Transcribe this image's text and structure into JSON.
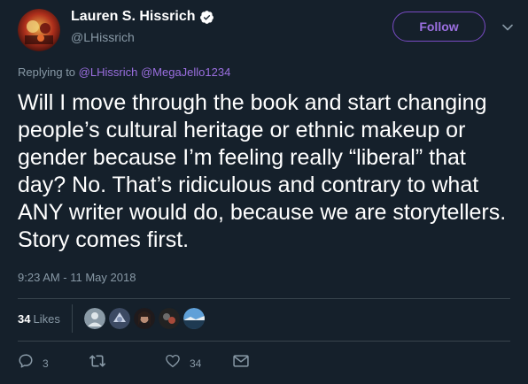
{
  "author": {
    "name": "Lauren S. Hissrich",
    "handle": "@LHissrich",
    "verified_icon": "verified-badge-icon",
    "follow_label": "Follow"
  },
  "reply": {
    "prefix": "Replying to",
    "mentions": [
      "@LHissrich",
      "@MegaJello1234"
    ]
  },
  "tweet": {
    "text": "Will I move through the book and start changing people’s cultural heritage or ethnic makeup or gender because I’m feeling really “liberal” that day? No. That’s ridiculous and contrary to what ANY writer would do, because we are storytellers. Story comes first.",
    "timestamp": "9:23 AM - 11 May 2018"
  },
  "stats": {
    "likes_count": "34",
    "likes_label": "Likes",
    "likers": [
      "liker-avatar",
      "liker-avatar",
      "liker-avatar",
      "liker-avatar",
      "liker-avatar"
    ]
  },
  "actions": {
    "reply_count": "3",
    "retweet_count": "",
    "like_count": "34"
  },
  "colors": {
    "background": "#15202b",
    "accent": "#794bc4",
    "muted_text": "#8899a6"
  }
}
